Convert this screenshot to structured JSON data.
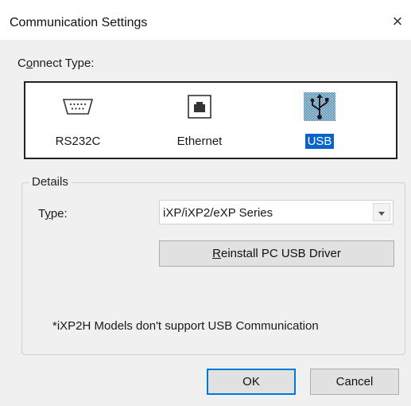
{
  "window": {
    "title": "Communication Settings",
    "close_glyph": "×"
  },
  "connect_type": {
    "label_prefix": "C",
    "label_mnemonic": "o",
    "label_suffix": "nnect Type:",
    "options": [
      {
        "label": "RS232C",
        "icon": "serial-port-icon",
        "selected": false
      },
      {
        "label": "Ethernet",
        "icon": "ethernet-port-icon",
        "selected": false
      },
      {
        "label": "USB",
        "icon": "usb-icon",
        "selected": true
      }
    ]
  },
  "details": {
    "legend": "Details",
    "type_label_prefix": "T",
    "type_label_mnemonic": "y",
    "type_label_suffix": "pe:",
    "type_value": "iXP/iXP2/eXP Series",
    "reinstall_mnemonic": "R",
    "reinstall_suffix": "einstall PC USB Driver",
    "note": "*iXP2H Models don't support USB Communication"
  },
  "footer": {
    "ok_label": "OK",
    "cancel_label": "Cancel"
  },
  "colors": {
    "selection": "#0a63c9",
    "default_button_border": "#0078d7"
  }
}
